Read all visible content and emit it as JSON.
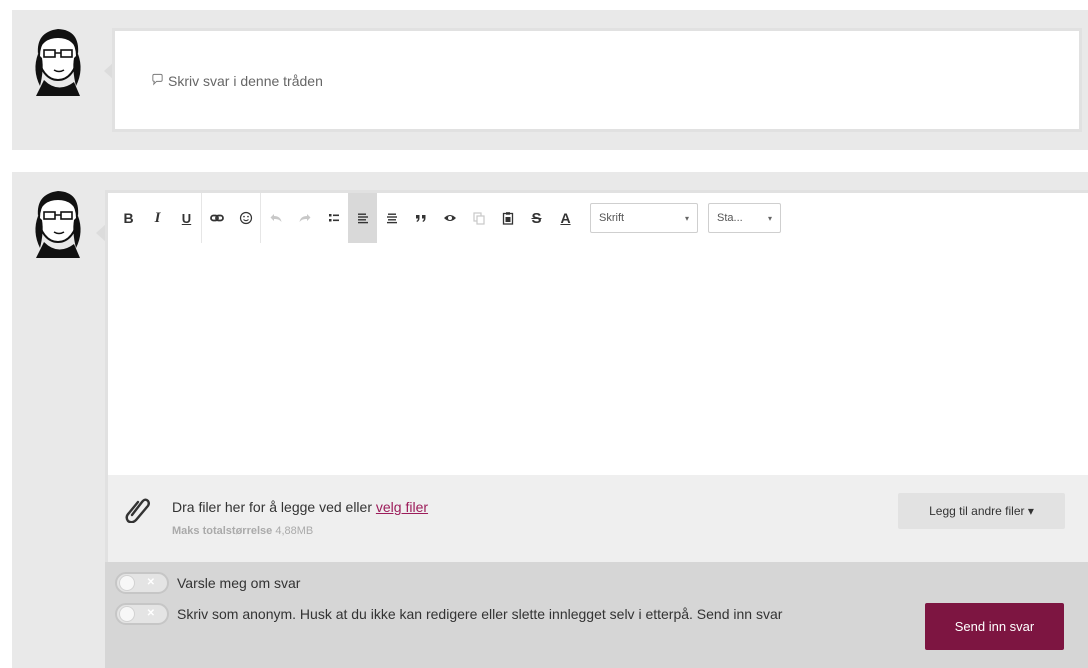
{
  "reply_prompt": {
    "placeholder": "Skriv svar i denne tråden",
    "icon": "comment-icon"
  },
  "toolbar": {
    "bold": "B",
    "italic": "I",
    "underline": "U",
    "strikethrough": "S",
    "font_color": "A",
    "font_select": "Skrift",
    "size_select": "Sta..."
  },
  "attachments": {
    "drop_text": "Dra filer her for å legge ved eller",
    "choose_files_link": "velg filer",
    "max_size_label": "Maks totalstørrelse",
    "max_size_value": "4,88MB",
    "other_files_button": "Legg til andre filer ▾"
  },
  "options": {
    "notify_label": "Varsle meg om svar",
    "anonymous_label": "Skriv som anonym. Husk at du ikke kan redigere eller slette innlegget selv i etterpå. Send inn svar",
    "toggle_off_symbol": "✕"
  },
  "submit": {
    "label": "Send inn svar"
  },
  "colors": {
    "accent": "#7d1541",
    "link": "#9c1c5a",
    "background": "#e9e9e9"
  }
}
